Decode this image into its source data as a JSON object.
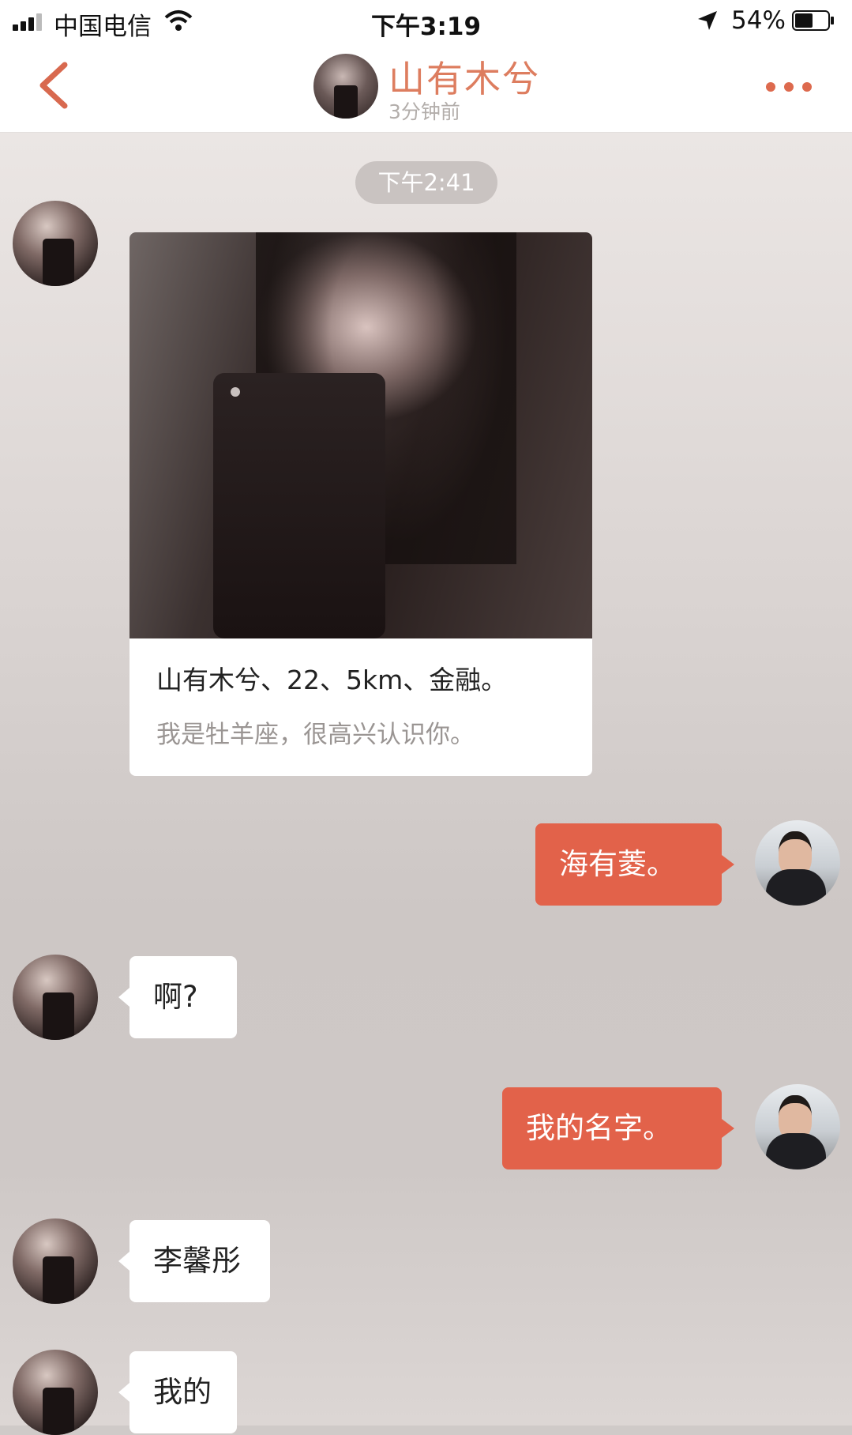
{
  "status_bar": {
    "carrier": "中国电信",
    "time": "下午3:19",
    "battery_percent": "54%",
    "battery_level": 0.54,
    "icons": [
      "signal-icon",
      "wifi-icon",
      "location-arrow-icon",
      "battery-icon"
    ]
  },
  "nav": {
    "contact_name": "山有木兮",
    "last_seen": "3分钟前",
    "icons": [
      "back-chevron-icon",
      "more-dots-icon"
    ],
    "accent_color": "#dd7d5f"
  },
  "chat": {
    "timestamp": "下午2:41",
    "profile_card": {
      "title": "山有木兮、22、5km、金融。",
      "description": "我是牡羊座，很高兴认识你。"
    },
    "messages": [
      {
        "from": "me",
        "text": "海有菱。"
      },
      {
        "from": "her",
        "text": "啊?"
      },
      {
        "from": "me",
        "text": "我的名字。"
      },
      {
        "from": "her",
        "text": "李馨彤"
      },
      {
        "from": "her",
        "text": "我的"
      }
    ],
    "colors": {
      "outgoing_bubble": "#e2624a",
      "incoming_bubble": "#ffffff"
    }
  }
}
